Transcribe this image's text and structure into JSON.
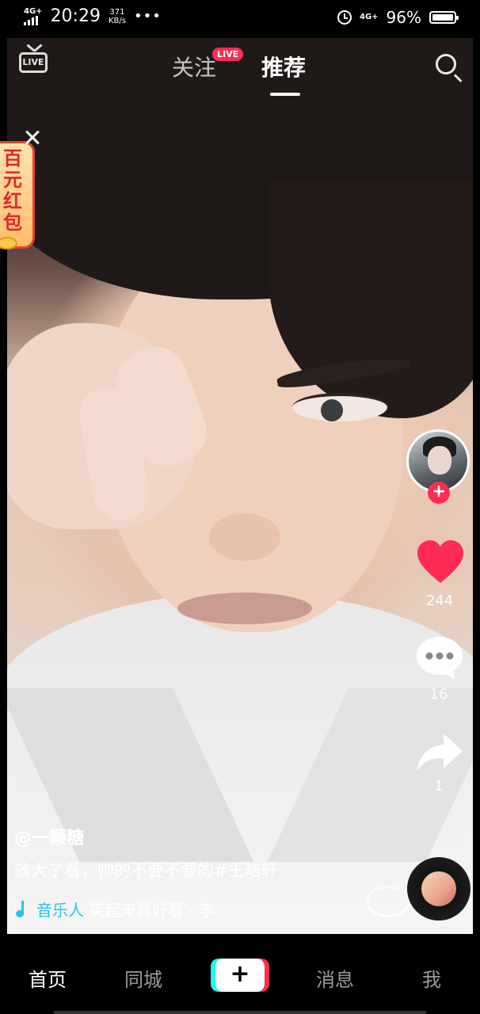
{
  "status_bar": {
    "network": "4G+",
    "time": "20:29",
    "speed_value": "371",
    "speed_unit": "KB/s",
    "dots": "•••",
    "right_network": "4G+",
    "battery_pct": "96%"
  },
  "top_nav": {
    "live_icon_text": "LIVE",
    "follow_tab": "关注",
    "live_badge": "LIVE",
    "recommend_tab": "推荐"
  },
  "red_packet": {
    "text": "百元红包"
  },
  "actions": {
    "follow_plus": "+",
    "likes": "244",
    "comments": "16",
    "shares": "1"
  },
  "caption": {
    "author": "@一颗糖",
    "text": "放大了看，帅的不要不要的#王皓轩",
    "music_source": "音乐人",
    "music_title": "笑起来真好看 - 李"
  },
  "bottom_nav": {
    "home": "首页",
    "nearby": "同城",
    "add": "+",
    "messages": "消息",
    "me": "我"
  },
  "colors": {
    "accent_red": "#fe2c55",
    "accent_cyan": "#25f4ee",
    "music_blue": "#25c4e8",
    "heart": "#fe2c55"
  },
  "icons": [
    "live-tv-icon",
    "search-icon",
    "close-icon",
    "heart-icon",
    "comment-icon",
    "share-icon",
    "music-note-icon",
    "alarm-icon",
    "battery-icon",
    "signal-icon"
  ]
}
